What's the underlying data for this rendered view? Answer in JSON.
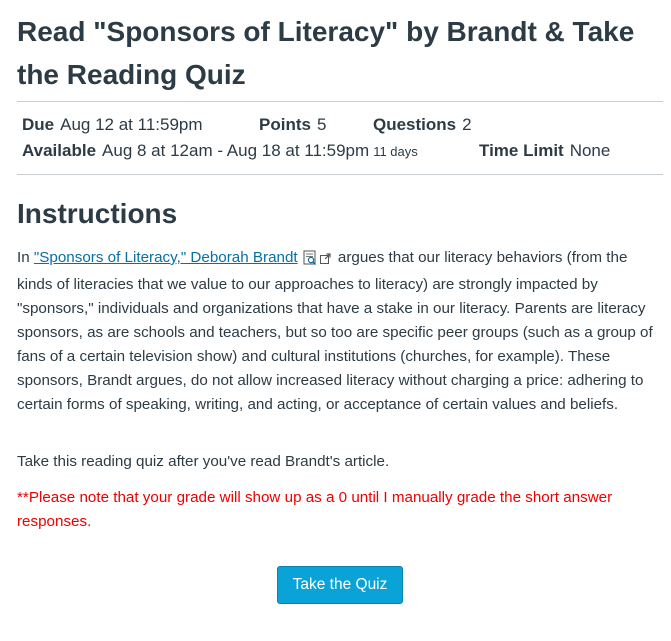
{
  "assignment": {
    "title": "Read \"Sponsors of Literacy\" by Brandt & Take the Reading Quiz"
  },
  "details": {
    "due_label": "Due",
    "due_value": "Aug 12 at 11:59pm",
    "points_label": "Points",
    "points_value": "5",
    "questions_label": "Questions",
    "questions_value": "2",
    "available_label": "Available",
    "available_value": "Aug 8 at 12am - Aug 18 at 11:59pm",
    "available_days": "11 days",
    "time_limit_label": "Time Limit",
    "time_limit_value": "None"
  },
  "instructions": {
    "heading": "Instructions",
    "p1_prefix": "In ",
    "p1_link": "\"Sponsors of Literacy,\" Deborah Brandt",
    "p1_rest": " argues that our literacy behaviors (from the kinds of literacies that we value to our approaches to literacy) are strongly impacted by \"sponsors,\" individuals and organizations that have a stake in our literacy. Parents are literacy sponsors, as are schools and teachers, but so too are specific peer groups (such as a group of fans of a certain television show) and cultural institutions (churches, for example). These sponsors, Brandt argues, do not allow increased literacy without charging a price: adhering to certain forms of speaking, writing, and acting, or acceptance of certain values and beliefs.",
    "p2": "Take this reading quiz after you've read Brandt's article.",
    "note": "**Please note that  your grade will show up as a 0 until I manually grade the short answer responses."
  },
  "actions": {
    "take_quiz": "Take the Quiz"
  },
  "icons": {
    "preview": "document-preview-icon",
    "external": "external-link-icon"
  },
  "colors": {
    "link": "#0770a3",
    "note": "#ee0000",
    "button": "#0aa3d8"
  }
}
